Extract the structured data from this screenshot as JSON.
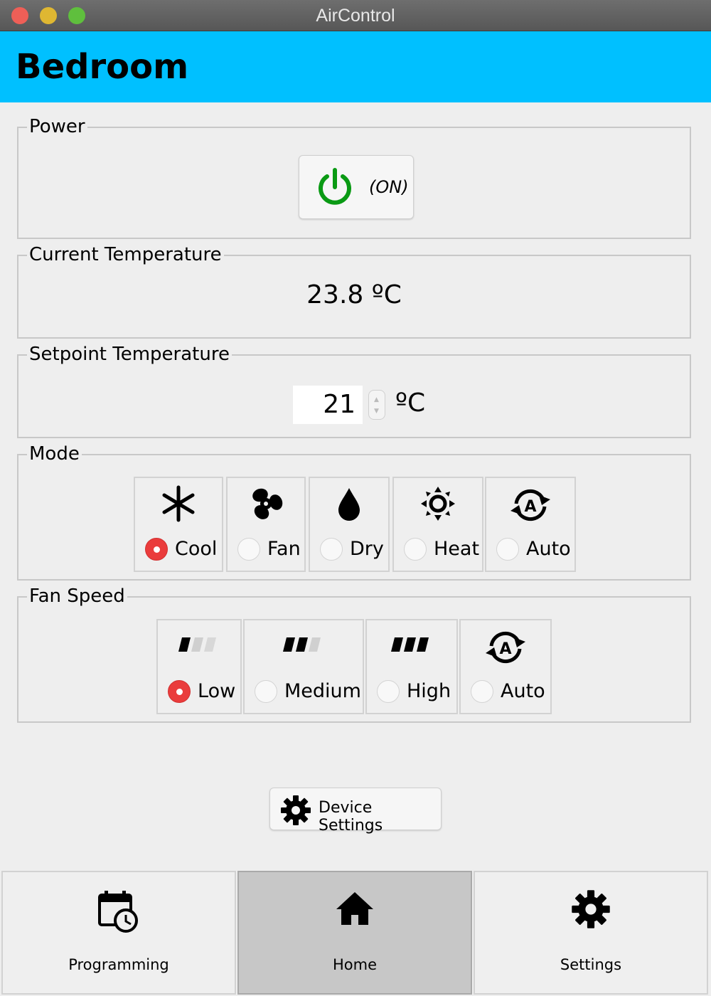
{
  "window": {
    "title": "AirControl"
  },
  "header": {
    "room": "Bedroom",
    "accent_color": "#00c0ff"
  },
  "power": {
    "legend": "Power",
    "state": "(ON)",
    "icon": "power-icon",
    "icon_color": "#0a9a14"
  },
  "current_temperature": {
    "legend": "Current Temperature",
    "value": "23.8 ºC"
  },
  "setpoint_temperature": {
    "legend": "Setpoint Temperature",
    "value": "21",
    "unit": "ºC"
  },
  "mode": {
    "legend": "Mode",
    "selected": "Cool",
    "options": [
      {
        "label": "Cool",
        "icon": "snowflake-icon"
      },
      {
        "label": "Fan",
        "icon": "fan-icon"
      },
      {
        "label": "Dry",
        "icon": "droplet-icon"
      },
      {
        "label": "Heat",
        "icon": "sun-icon"
      },
      {
        "label": "Auto",
        "icon": "auto-cycle-icon"
      }
    ]
  },
  "fan_speed": {
    "legend": "Fan Speed",
    "selected": "Low",
    "options": [
      {
        "label": "Low",
        "icon": "speed-low-icon"
      },
      {
        "label": "Medium",
        "icon": "speed-medium-icon"
      },
      {
        "label": "High",
        "icon": "speed-high-icon"
      },
      {
        "label": "Auto",
        "icon": "auto-cycle-icon"
      }
    ]
  },
  "device_settings": {
    "label": "Device Settings",
    "icon": "gear-icon"
  },
  "bottom_nav": {
    "active": "Home",
    "items": [
      {
        "label": "Programming",
        "icon": "calendar-clock-icon"
      },
      {
        "label": "Home",
        "icon": "home-icon"
      },
      {
        "label": "Settings",
        "icon": "gear-icon"
      }
    ]
  },
  "selection_color": "#ea3c3c"
}
